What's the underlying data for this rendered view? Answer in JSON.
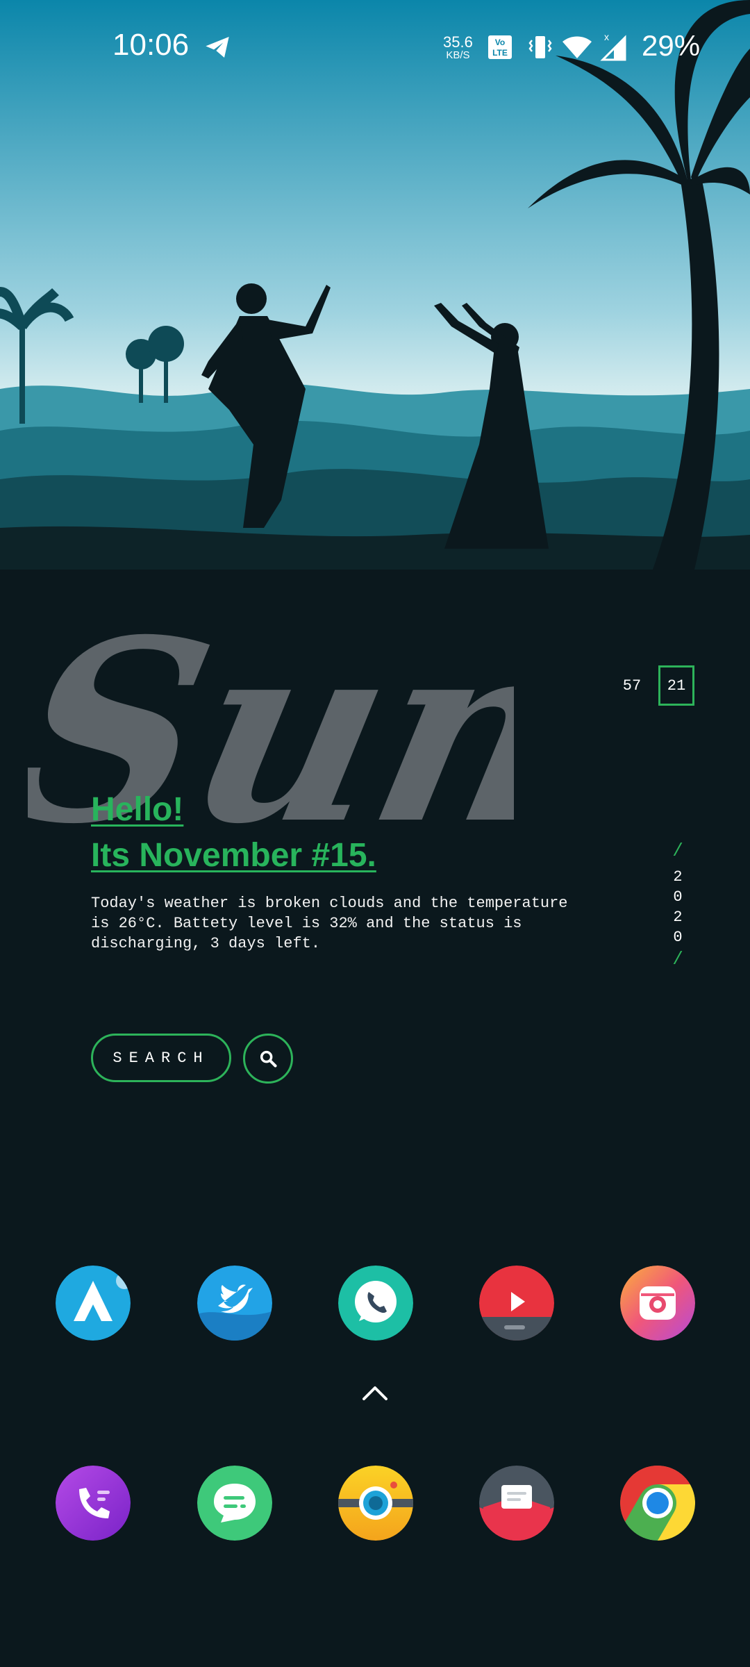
{
  "status_bar": {
    "time": "10:06",
    "network_speed": "35.6",
    "network_speed_unit": "KB/S",
    "battery": "29%",
    "icons": [
      "telegram-icon",
      "volte-icon",
      "vibrate-icon",
      "wifi-icon",
      "signal-icon"
    ]
  },
  "widget": {
    "brush_word": "Sun.",
    "day_prev": "57",
    "day_current": "21",
    "greeting_line1": "Hello!",
    "greeting_line2": "Its November #15.",
    "info": "Today's weather is broken clouds and the temperature\nis 26°C. Battety level is 32% and the status is\ndischarging, 3 days left.",
    "year_slash_top": "/",
    "year_digits": [
      "2",
      "0",
      "2",
      "0"
    ],
    "year_slash_bottom": "/",
    "search_label": "SEARCH"
  },
  "apps_row1": [
    "arrow-launcher-icon",
    "twitter-icon",
    "whatsapp-icon",
    "youtube-icon",
    "instagram-icon"
  ],
  "apps_dock": [
    "phone-icon",
    "messages-icon",
    "camera-icon",
    "email-icon",
    "chrome-icon"
  ],
  "colors": {
    "accent": "#2db35a",
    "background": "#0b181d"
  }
}
